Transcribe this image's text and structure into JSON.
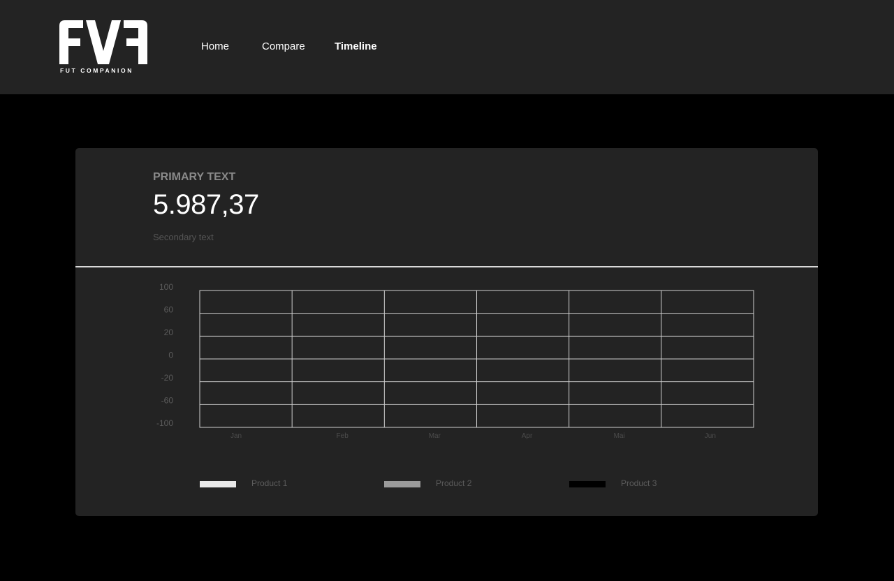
{
  "header": {
    "logo_text": "FVF",
    "logo_subtitle": "FUT COMPANION",
    "nav": [
      {
        "label": "Home",
        "active": false
      },
      {
        "label": "Compare",
        "active": false
      },
      {
        "label": "Timeline",
        "active": true
      }
    ]
  },
  "card": {
    "primary_label": "PRIMARY TEXT",
    "value": "5.987,37",
    "secondary": "Secondary text"
  },
  "chart_data": {
    "type": "line",
    "categories": [
      "Jan",
      "Feb",
      "Mar",
      "Apr",
      "Mai",
      "Jun"
    ],
    "y_ticks": [
      "100",
      "60",
      "20",
      "0",
      "-20",
      "-60",
      "-100"
    ],
    "ylim": [
      -100,
      100
    ],
    "grid": true,
    "series": [
      {
        "name": "Product 1",
        "color": "#e8e8e8",
        "values": []
      },
      {
        "name": "Product 2",
        "color": "#9a9a9a",
        "values": []
      },
      {
        "name": "Product 3",
        "color": "#000000",
        "values": []
      }
    ],
    "legend_placement": "bottom"
  }
}
